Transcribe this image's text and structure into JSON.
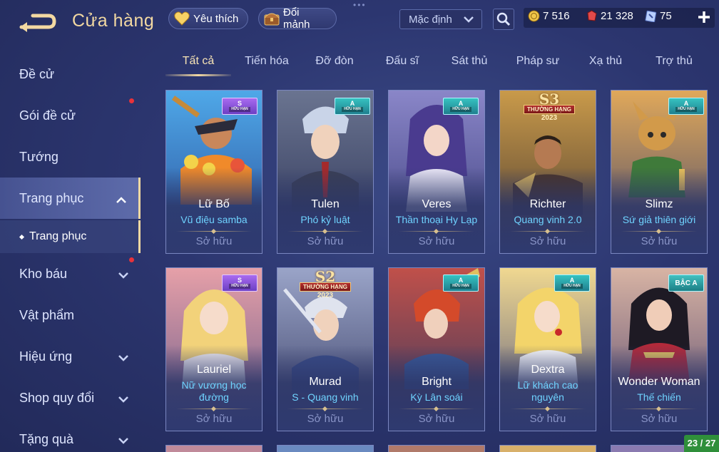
{
  "header": {
    "title": "Cửa hàng",
    "favorites_label": "Yêu thích",
    "shard_label": "Đổi mảnh",
    "sort_value": "Mặc định",
    "currencies": {
      "gold": "7 516",
      "ruby": "21 328",
      "voucher": "75"
    },
    "colors": {
      "accent": "#f3d9a2",
      "background": "#2c3670",
      "skin_name": "#6fd3ff"
    }
  },
  "sidebar": {
    "items": [
      {
        "label": "Đề cử"
      },
      {
        "label": "Gói đề cử"
      },
      {
        "label": "Tướng"
      },
      {
        "label": "Trang phục"
      },
      {
        "label": "Kho báu"
      },
      {
        "label": "Vật phẩm"
      },
      {
        "label": "Hiệu ứng"
      },
      {
        "label": "Shop quy đổi"
      },
      {
        "label": "Tặng quà"
      }
    ],
    "sub_item": "Trang phục"
  },
  "tabs": [
    "Tất cả",
    "Tiến hóa",
    "Đỡ đòn",
    "Đấu sĩ",
    "Sát thủ",
    "Pháp sư",
    "Xạ thủ",
    "Trợ thủ"
  ],
  "cards": [
    {
      "hero": "Lữ Bố",
      "skin": "Vũ điệu samba",
      "status": "Sở hữu",
      "badge": "S",
      "badge_sub": "HỮU HẠN"
    },
    {
      "hero": "Tulen",
      "skin": "Phó kỷ luật",
      "status": "Sở hữu",
      "badge": "A",
      "badge_sub": "HỮU HẠN"
    },
    {
      "hero": "Veres",
      "skin": "Thần thoại Hy Lạp",
      "status": "Sở hữu",
      "badge": "A",
      "badge_sub": "HỮU HẠN"
    },
    {
      "hero": "Richter",
      "skin": "Quang vinh 2.0",
      "status": "Sở hữu",
      "rank": "S3",
      "rank_label": "THƯỜNG HẠNG",
      "rank_year": "2023"
    },
    {
      "hero": "Slimz",
      "skin": "Sứ giả thiên giới",
      "status": "Sở hữu",
      "badge": "A",
      "badge_sub": "HỮU HẠN"
    },
    {
      "hero": "Lauriel",
      "skin": "Nữ vương học đường",
      "status": "Sở hữu",
      "badge": "S",
      "badge_sub": "HỮU HẠN"
    },
    {
      "hero": "Murad",
      "skin": "S - Quang vinh",
      "status": "Sở hữu",
      "rank": "S2",
      "rank_label": "THƯỜNG HẠNG",
      "rank_year": "2023"
    },
    {
      "hero": "Bright",
      "skin": "Kỳ Lân soái",
      "status": "Sở hữu",
      "badge": "A",
      "badge_sub": "HỮU HẠN"
    },
    {
      "hero": "Dextra",
      "skin": "Lữ khách cao nguyên",
      "status": "Sở hữu",
      "badge": "A",
      "badge_sub": "HỮU HẠN"
    },
    {
      "hero": "Wonder Woman",
      "skin": "Thế chiến",
      "status": "Sở hữu",
      "badge": "BẬC A"
    }
  ],
  "page_indicator": "23 / 27"
}
